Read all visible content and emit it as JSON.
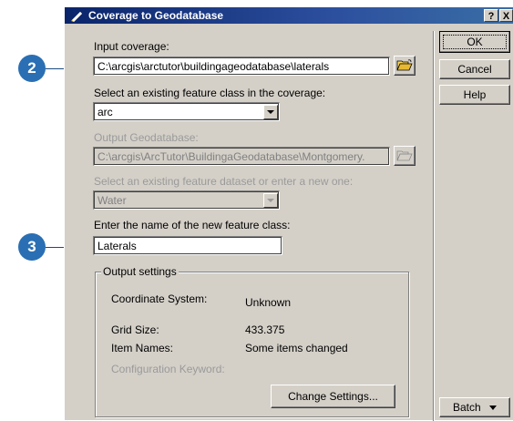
{
  "window": {
    "title": "Coverage to Geodatabase"
  },
  "titlebar_buttons": {
    "help": "?",
    "close": "X"
  },
  "callouts": [
    "2",
    "3"
  ],
  "form": {
    "input_coverage_label": "Input coverage:",
    "input_coverage_value": "C:\\arcgis\\arctutor\\buildingageodatabase\\laterals",
    "feature_class_label": "Select an existing feature class in the coverage:",
    "feature_class_value": "arc",
    "output_gdb_label": "Output Geodatabase:",
    "output_gdb_value": "C:\\arcgis\\ArcTutor\\BuildingaGeodatabase\\Montgomery.",
    "dataset_label": "Select an existing feature dataset or enter a new one:",
    "dataset_value": "Water",
    "new_class_label": "Enter the name of the new feature class:",
    "new_class_value": "Laterals"
  },
  "output_settings": {
    "legend": "Output settings",
    "coord_label": "Coordinate System:",
    "coord_value": "Unknown",
    "grid_label": "Grid Size:",
    "grid_value": "433.375",
    "items_label": "Item Names:",
    "items_value": "Some items changed",
    "config_label": "Configuration Keyword:",
    "change_button": "Change Settings..."
  },
  "buttons": {
    "ok": "OK",
    "cancel": "Cancel",
    "help": "Help",
    "batch": "Batch"
  }
}
